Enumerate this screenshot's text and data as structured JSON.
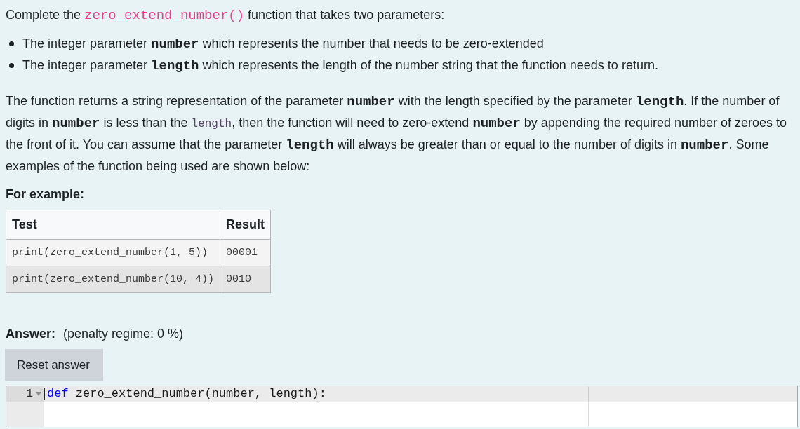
{
  "intro": {
    "runs": [
      {
        "kind": "text",
        "text": "Complete the "
      },
      {
        "kind": "code",
        "text": "zero_extend_number()"
      },
      {
        "kind": "text",
        "text": " function that takes two parameters:"
      }
    ]
  },
  "parameters": [
    {
      "runs": [
        {
          "kind": "text",
          "text": "The integer parameter "
        },
        {
          "kind": "var",
          "text": "number"
        },
        {
          "kind": "text",
          "text": " which represents the number that needs to be zero-extended"
        }
      ]
    },
    {
      "runs": [
        {
          "kind": "text",
          "text": "The integer parameter "
        },
        {
          "kind": "var",
          "text": "length"
        },
        {
          "kind": "text",
          "text": " which represents the length of the number string that the function needs to return."
        }
      ]
    }
  ],
  "description": {
    "runs": [
      {
        "kind": "text",
        "text": "The function returns a string representation of the parameter "
      },
      {
        "kind": "var",
        "text": "number"
      },
      {
        "kind": "text",
        "text": " with the length specified by the parameter "
      },
      {
        "kind": "var",
        "text": "length"
      },
      {
        "kind": "text",
        "text": ". If the number of digits in "
      },
      {
        "kind": "var",
        "text": "number"
      },
      {
        "kind": "text",
        "text": " is less than the "
      },
      {
        "kind": "mono",
        "text": "length"
      },
      {
        "kind": "text",
        "text": ", then the function will need to zero-extend "
      },
      {
        "kind": "var",
        "text": "number"
      },
      {
        "kind": "text",
        "text": " by appending the required number of zeroes to the front of it. You can assume that the parameter "
      },
      {
        "kind": "var",
        "text": "length"
      },
      {
        "kind": "text",
        "text": " will always be greater than or equal to the number of digits in "
      },
      {
        "kind": "var",
        "text": "number"
      },
      {
        "kind": "text",
        "text": ". Some examples of the function being used are shown below:"
      }
    ]
  },
  "example_heading": "For example:",
  "example_table": {
    "columns": [
      "Test",
      "Result"
    ],
    "rows": [
      [
        "print(zero_extend_number(1, 5))",
        "00001"
      ],
      [
        "print(zero_extend_number(10, 4))",
        "0010"
      ]
    ]
  },
  "answer": {
    "label": "Answer:",
    "penalty": "(penalty regime: 0 %)",
    "reset_button": "Reset answer"
  },
  "editor": {
    "lines": [
      {
        "number": "1",
        "foldable": true,
        "active": true,
        "cursor": true,
        "tokens": [
          {
            "kind": "keyword",
            "text": "def"
          },
          {
            "kind": "text",
            "text": " zero_extend_number(number, length):"
          }
        ]
      }
    ]
  }
}
